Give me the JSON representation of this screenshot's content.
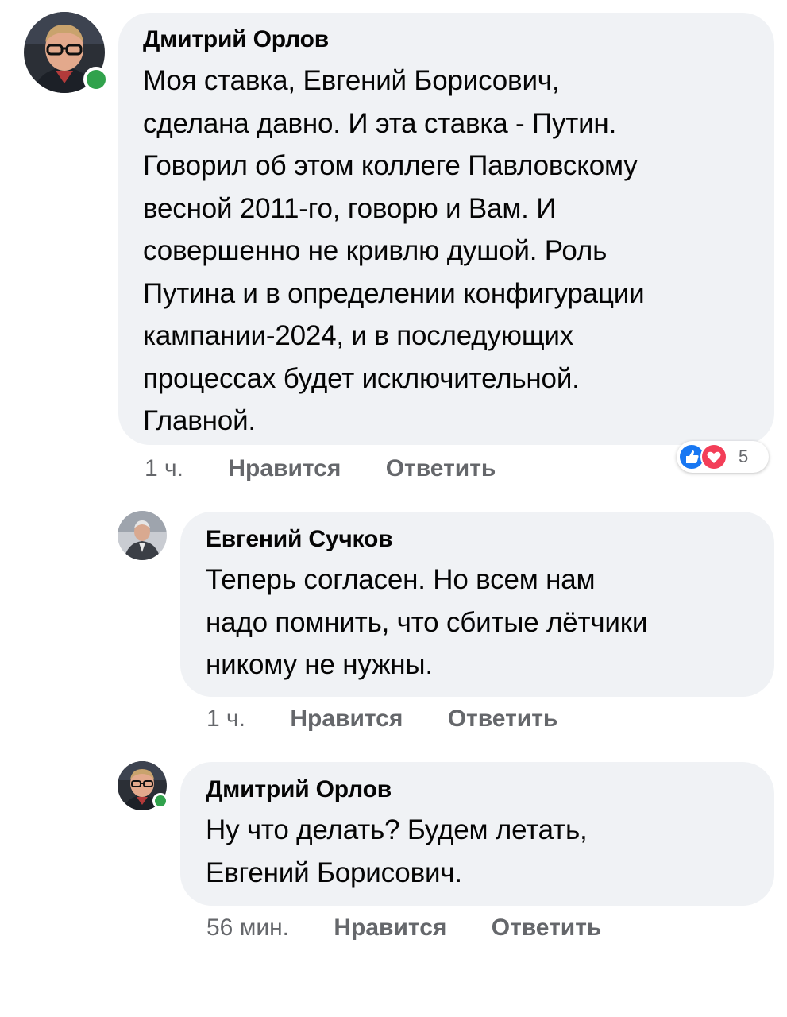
{
  "colors": {
    "bubble_bg": "#f0f2f5",
    "meta_text": "#65676b",
    "online": "#31a24c",
    "like_blue": "#1877f2",
    "love_red": "#f33e58"
  },
  "comments": [
    {
      "author": "Дмитрий Орлов",
      "online": true,
      "lines": [
        "Моя ставка, Евгений Борисович,",
        "сделана давно. И эта ставка - Путин.",
        "Говорил об этом коллеге Павловскому",
        "весной 2011-го, говорю и Вам. И",
        "совершенно не кривлю душой. Роль",
        "Путина и в определении конфигурации",
        "кампании-2024, и в последующих",
        "процессах будет исключительной.",
        "Главной."
      ],
      "time": "1 ч.",
      "like_label": "Нравится",
      "reply_label": "Ответить",
      "reactions": {
        "icons": [
          "like-icon",
          "love-icon"
        ],
        "count": "5"
      }
    },
    {
      "author": "Евгений Сучков",
      "online": false,
      "lines": [
        "Теперь согласен. Но всем нам",
        "надо помнить, что сбитые лётчики",
        "никому не нужны."
      ],
      "time": "1 ч.",
      "like_label": "Нравится",
      "reply_label": "Ответить"
    },
    {
      "author": "Дмитрий Орлов",
      "online": true,
      "lines": [
        "Ну что делать? Будем летать,",
        "Евгений Борисович."
      ],
      "time": "56 мин.",
      "like_label": "Нравится",
      "reply_label": "Ответить"
    }
  ]
}
